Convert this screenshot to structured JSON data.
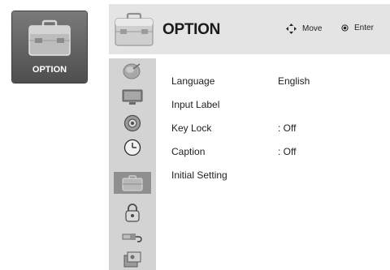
{
  "tile": {
    "label": "OPTION",
    "icon": "toolbox-icon"
  },
  "header": {
    "title": "OPTION",
    "hints": [
      {
        "icon": "move-arrows-icon",
        "label": "Move"
      },
      {
        "icon": "enter-dot-icon",
        "label": "Enter"
      }
    ]
  },
  "sidebar": {
    "items": [
      {
        "icon": "satellite-dish-icon"
      },
      {
        "icon": "monitor-icon"
      },
      {
        "icon": "speaker-icon"
      },
      {
        "icon": "clock-icon"
      },
      {
        "icon": "toolbox-icon",
        "active": true
      },
      {
        "icon": "lock-icon"
      },
      {
        "icon": "usb-icon"
      },
      {
        "icon": "media-icon"
      }
    ]
  },
  "menu": [
    {
      "label": "Language",
      "value": "English"
    },
    {
      "label": "Input Label",
      "value": ""
    },
    {
      "label": "Key Lock",
      "value": ": Off"
    },
    {
      "label": "Caption",
      "value": ": Off"
    },
    {
      "label": "Initial Setting",
      "value": ""
    }
  ],
  "colors": {
    "tile_bg": "#5f5f5f",
    "header_bg": "#e4e4e4",
    "sidebar_bg": "#d3d3d3",
    "sidebar_active": "#8f8f8f"
  }
}
